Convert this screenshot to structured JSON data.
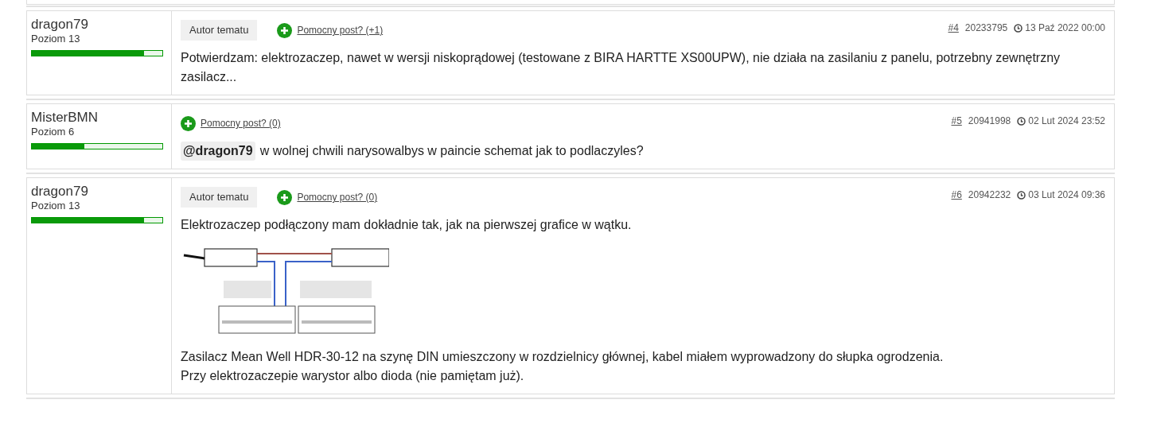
{
  "posts": [
    {
      "author": "dragon79",
      "rank": "Poziom 13",
      "level": 0.86,
      "badge": "Autor tematu",
      "helpful": "Pomocny post? (+1)",
      "number": "#4",
      "id": "20233795",
      "date": "13 Paź 2022 00:00",
      "body": [
        {
          "kind": "text",
          "text": "Potwierdzam: elektrozaczep, nawet w wersji niskoprądowej (testowane z BIRA HARTTE XS00UPW), nie działa na zasilaniu z panelu, potrzebny zewnętrzny zasilacz..."
        }
      ]
    },
    {
      "author": "MisterBMN",
      "rank": "Poziom 6",
      "level": 0.4,
      "helpful": "Pomocny post? (0)",
      "number": "#5",
      "id": "20941998",
      "date": "02 Lut 2024 23:52",
      "body": [
        {
          "kind": "mention_text",
          "mention": "@dragon79",
          "text": "w wolnej chwili narysowalbys w paincie schemat jak to podlaczyles?"
        }
      ]
    },
    {
      "author": "dragon79",
      "rank": "Poziom 13",
      "level": 0.86,
      "badge": "Autor tematu",
      "helpful": "Pomocny post? (0)",
      "number": "#6",
      "id": "20942232",
      "date": "03 Lut 2024 09:36",
      "body": [
        {
          "kind": "text",
          "text": "Elektrozaczep podłączony mam dokładnie tak, jak na pierwszej grafice w wątku."
        },
        {
          "kind": "picture"
        },
        {
          "kind": "text",
          "text": "Zasilacz Mean Well HDR-30-12 na szynę DIN umieszczony w rozdzielnicy głównej, kabel miałem wyprowadzony do słupka ogrodzenia."
        },
        {
          "kind": "text",
          "text": "Przy elektrozaczepie warystor albo dioda (nie pamiętam już)."
        }
      ]
    }
  ]
}
